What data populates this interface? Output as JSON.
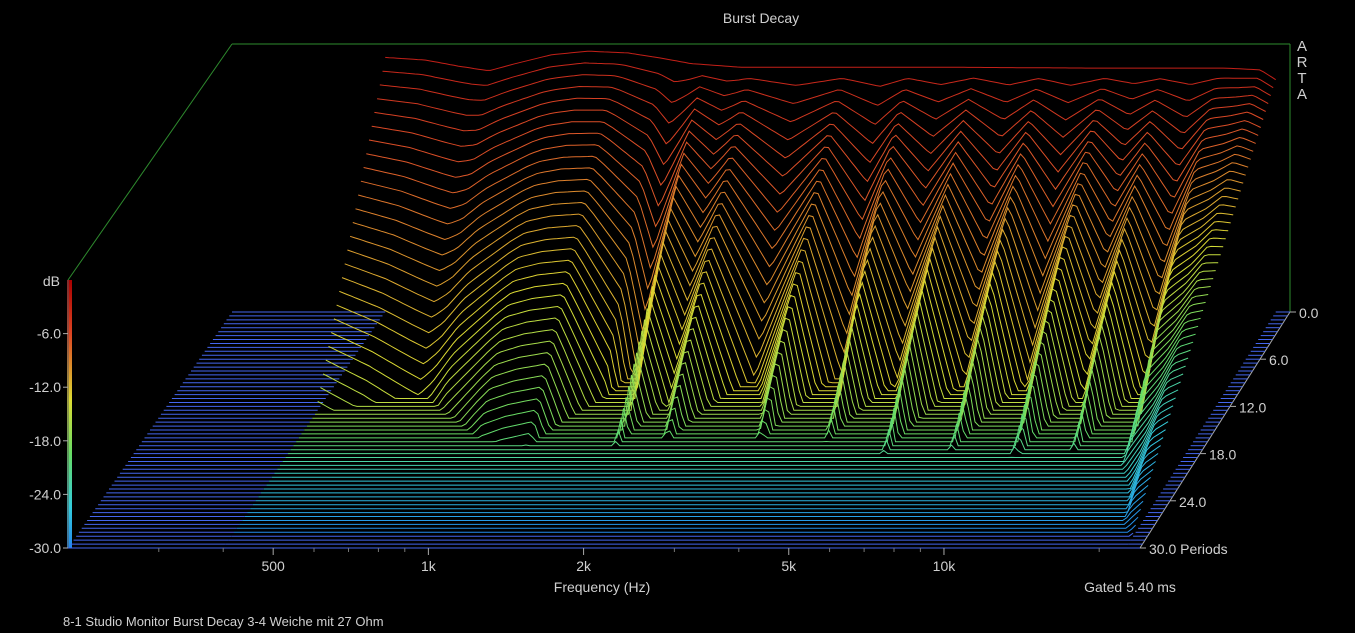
{
  "chart_data": {
    "type": "waterfall",
    "title": "Burst Decay",
    "watermark": "ARTA",
    "xlabel": "Frequency (Hz)",
    "x_tick_labels": [
      {
        "label": "500",
        "value": 500
      },
      {
        "label": "1k",
        "value": 1000
      },
      {
        "label": "2k",
        "value": 2000
      },
      {
        "label": "5k",
        "value": 5000
      },
      {
        "label": "10k",
        "value": 10000
      }
    ],
    "x_scale": "log",
    "xlim": [
      200,
      24000
    ],
    "zlabel": "dB",
    "z_tick_labels": [
      "-6.0",
      "-12.0",
      "-18.0",
      "-24.0",
      "-30.0"
    ],
    "z_tick_values": [
      -6,
      -12,
      -18,
      -24,
      -30
    ],
    "zlim": [
      -30,
      0
    ],
    "y_tick_labels": [
      "0.0",
      "6.0",
      "12.0",
      "18.0",
      "24.0",
      "30.0 Periods"
    ],
    "y_tick_values": [
      0,
      6,
      12,
      18,
      24,
      30
    ],
    "ylim": [
      0,
      30
    ],
    "gating": "Gated 5.40 ms",
    "caption": "8-1 Studio Monitor Burst Decay 3-4 Weiche mit 27 Ohm",
    "colors": {
      "background": "#000000",
      "frame": "#2e8b2e",
      "floor_lines": "#4466ee",
      "scale_top": "#cc2222",
      "scale_mid": "#dddd33",
      "scale_low": "#33ccdd"
    },
    "base_response_db": [
      {
        "f": 400,
        "db": -1.5
      },
      {
        "f": 480,
        "db": -1.8
      },
      {
        "f": 560,
        "db": -2.5
      },
      {
        "f": 640,
        "db": -3.0
      },
      {
        "f": 720,
        "db": -2.2
      },
      {
        "f": 850,
        "db": -1.2
      },
      {
        "f": 1000,
        "db": -0.8
      },
      {
        "f": 1200,
        "db": -1.0
      },
      {
        "f": 1400,
        "db": -1.6
      },
      {
        "f": 1600,
        "db": -2.2
      },
      {
        "f": 2000,
        "db": -2.6
      },
      {
        "f": 3000,
        "db": -2.6
      },
      {
        "f": 5000,
        "db": -2.6
      },
      {
        "f": 10000,
        "db": -2.7
      },
      {
        "f": 18000,
        "db": -2.7
      },
      {
        "f": 21000,
        "db": -2.9
      },
      {
        "f": 22500,
        "db": -4.0
      }
    ],
    "decay_rate_db_per_period": [
      {
        "f": 400,
        "rate": 2.2
      },
      {
        "f": 600,
        "rate": 2.6
      },
      {
        "f": 700,
        "rate": 2.2
      },
      {
        "f": 900,
        "rate": 1.8
      },
      {
        "f": 1150,
        "rate": 1.7
      },
      {
        "f": 1400,
        "rate": 2.6
      },
      {
        "f": 1500,
        "rate": 3.8
      },
      {
        "f": 1700,
        "rate": 1.6
      },
      {
        "f": 1900,
        "rate": 2.4
      },
      {
        "f": 2100,
        "rate": 1.6
      },
      {
        "f": 2600,
        "rate": 3.2
      },
      {
        "f": 3200,
        "rate": 1.6
      },
      {
        "f": 3800,
        "rate": 3.4
      },
      {
        "f": 4300,
        "rate": 1.6
      },
      {
        "f": 5000,
        "rate": 3.0
      },
      {
        "f": 5800,
        "rate": 1.5
      },
      {
        "f": 6800,
        "rate": 3.0
      },
      {
        "f": 7800,
        "rate": 1.5
      },
      {
        "f": 9000,
        "rate": 3.0
      },
      {
        "f": 10500,
        "rate": 1.4
      },
      {
        "f": 12000,
        "rate": 2.6
      },
      {
        "f": 13500,
        "rate": 1.5
      },
      {
        "f": 15500,
        "rate": 2.8
      },
      {
        "f": 17500,
        "rate": 1.4
      },
      {
        "f": 19500,
        "rate": 1.2
      },
      {
        "f": 21000,
        "rate": 1.0
      },
      {
        "f": 22500,
        "rate": 0.9
      }
    ]
  }
}
